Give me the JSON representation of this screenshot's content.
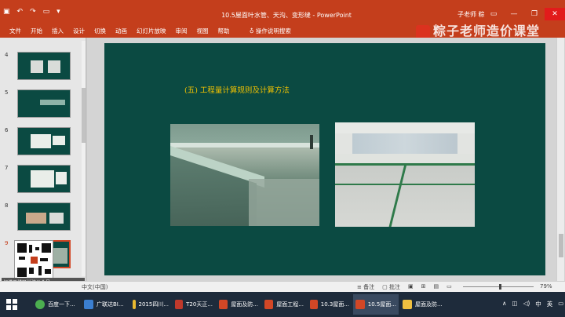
{
  "window": {
    "title": "10.5屋面叶水管、天沟、变形缝 - PowerPoint",
    "user": "子老师 粽",
    "qat_icons": [
      "save-icon",
      "undo-icon",
      "redo-icon",
      "present-icon",
      "customize-icon"
    ]
  },
  "ribbon": {
    "tabs": [
      "文件",
      "开始",
      "插入",
      "设计",
      "切换",
      "动画",
      "幻灯片放映",
      "审阅",
      "视图",
      "帮助"
    ],
    "tell_me": "操作说明搜索",
    "watermark": "粽子老师造价课堂"
  },
  "thumbnails": {
    "numbers": [
      "4",
      "5",
      "6",
      "7",
      "8",
      "9"
    ],
    "qr_caption": "扫描二维码关注公众号"
  },
  "slide": {
    "heading": "(五) 工程量计算规则及计算方法"
  },
  "statusbar": {
    "language": "中文(中国)",
    "notes": "备注",
    "comments": "批注",
    "zoom": "79%",
    "zoom_fraction": 0.52
  },
  "taskbar": {
    "items": [
      "百度一下...",
      "广联达BI...",
      "2015四川...",
      "T20天正...",
      "屋面及防...",
      "屋面工程...",
      "10.3屋面...",
      "10.5屋面...",
      "屋面及防..."
    ],
    "tray_ime": "中",
    "tray_ime2": "英"
  },
  "colors": {
    "accent": "#c43e1c",
    "slide_bg": "#0b4a42",
    "heading": "#f2c200"
  }
}
